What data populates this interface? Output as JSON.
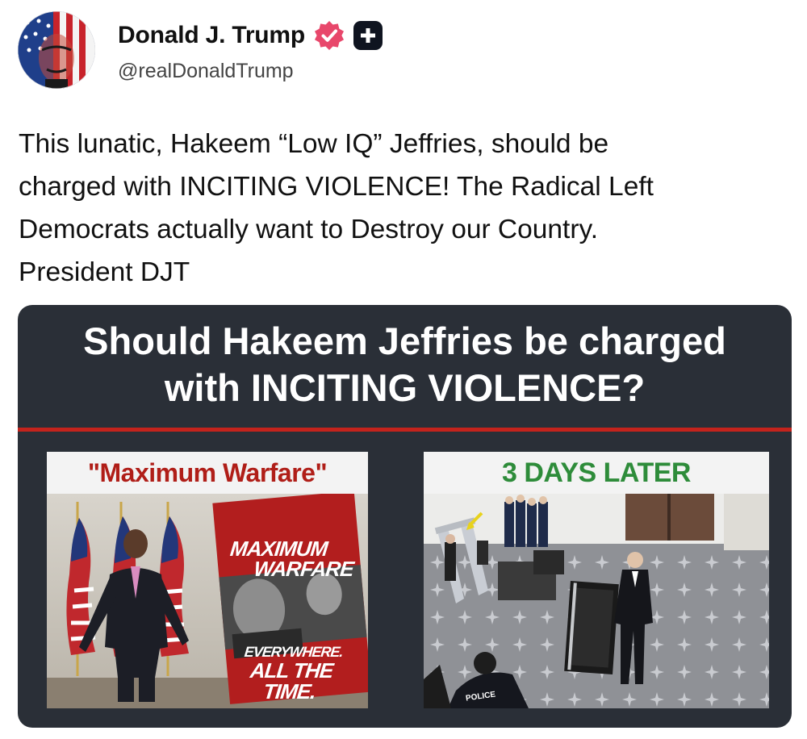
{
  "account": {
    "display_name": "Donald J. Trump",
    "handle": "@realDonaldTrump",
    "avatar_icon": "profile-avatar-icon",
    "verified_icon": "verified-badge-icon",
    "verified_color": "#e8476b",
    "extra_icon": "plus-badge-icon"
  },
  "post": {
    "lines": [
      "This lunatic, Hakeem “Low IQ” Jeffries, should be",
      "charged with INCITING VIOLENCE! The Radical Left",
      "Democrats actually want to Destroy our Country.",
      "President DJT"
    ]
  },
  "image": {
    "headline_line1": "Should Hakeem Jeffries be charged",
    "headline_line2": "with INCITING VIOLENCE?",
    "accent_color": "#c4231c",
    "left_panel": {
      "title": "\"Maximum Warfare\"",
      "title_color": "#b01e18",
      "poster_line1": "MAXIMUM",
      "poster_line2": "WARFARE",
      "poster_line3": "EVERYWHERE.",
      "poster_line4": "ALL THE TIME."
    },
    "right_panel": {
      "title": "3 DAYS LATER",
      "title_color": "#2e8c3a",
      "vest_text": "POLICE"
    }
  }
}
